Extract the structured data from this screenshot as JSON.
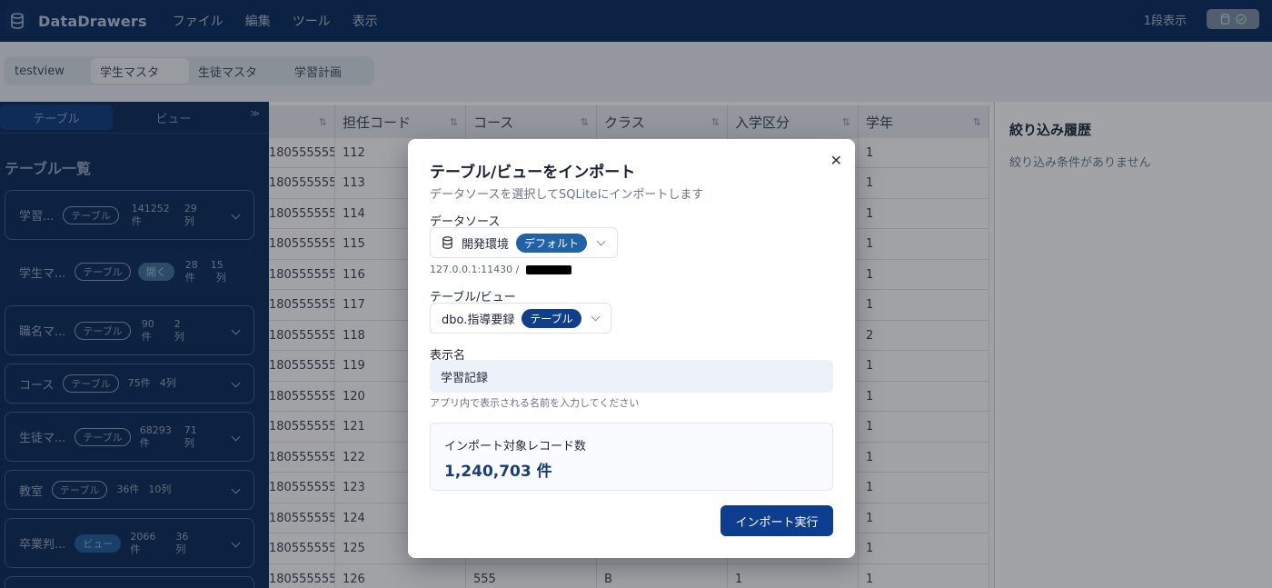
{
  "app": {
    "name": "DataDrawers"
  },
  "menu": [
    "ファイル",
    "編集",
    "ツール",
    "表示"
  ],
  "header_right": {
    "display_mode": "1段表示"
  },
  "tabs": [
    {
      "label": "testview"
    },
    {
      "label": "学生マスタ"
    },
    {
      "label": "生徒マスタ"
    },
    {
      "label": "学習計画"
    }
  ],
  "sidebar": {
    "toggle": {
      "table_label": "テーブル",
      "view_label": "ビュー"
    },
    "title": "テーブル一覧",
    "items": [
      {
        "name": "学習...",
        "type": "テーブル",
        "count": "141252",
        "count_unit": "件",
        "cols": "29",
        "cols_unit": "列"
      },
      {
        "name": "学生マ...",
        "type": "テーブル",
        "open": "開く",
        "count": "28",
        "count_unit": "件",
        "cols": "15",
        "cols_unit": "列"
      },
      {
        "name": "職名マ...",
        "type": "テーブル",
        "count": "90",
        "count_unit": "件",
        "cols": "2",
        "cols_unit": "列"
      },
      {
        "name": "コース",
        "type": "テーブル",
        "count_inline": "75件",
        "cols_inline": "4列"
      },
      {
        "name": "生徒マ...",
        "type": "テーブル",
        "count": "68293",
        "count_unit": "件",
        "cols": "71",
        "cols_unit": "列"
      },
      {
        "name": "教室",
        "type": "テーブル",
        "count_inline": "36件",
        "cols_inline": "10列"
      },
      {
        "name": "卒業判...",
        "type": "ビュー",
        "count": "2066",
        "count_unit": "件",
        "cols": "36",
        "cols_unit": "列"
      }
    ]
  },
  "grid": {
    "columns": [
      "",
      "担任コード",
      "コース",
      "クラス",
      "入学区分",
      "学年"
    ],
    "rows": [
      [
        "180555555",
        "112",
        "",
        "",
        "",
        "1"
      ],
      [
        "180555555",
        "113",
        "",
        "",
        "",
        "1"
      ],
      [
        "180555555",
        "114",
        "",
        "",
        "",
        "1"
      ],
      [
        "180555555",
        "115",
        "",
        "",
        "",
        "1"
      ],
      [
        "180555555",
        "116",
        "",
        "",
        "",
        "1"
      ],
      [
        "180555555",
        "117",
        "",
        "",
        "",
        "1"
      ],
      [
        "180555555",
        "118",
        "",
        "",
        "",
        "2"
      ],
      [
        "180555555",
        "119",
        "",
        "",
        "",
        "1"
      ],
      [
        "180555555",
        "120",
        "",
        "",
        "",
        "1"
      ],
      [
        "180555555",
        "121",
        "",
        "",
        "",
        "1"
      ],
      [
        "180555555",
        "122",
        "",
        "",
        "",
        "1"
      ],
      [
        "180555555",
        "123",
        "",
        "",
        "",
        "1"
      ],
      [
        "180555555",
        "124",
        "",
        "",
        "",
        "1"
      ],
      [
        "180555555",
        "125",
        "",
        "",
        "",
        "1"
      ],
      [
        "180555555",
        "126",
        "555",
        "B",
        "1",
        "1"
      ]
    ]
  },
  "filter_panel": {
    "title": "絞り込み履歴",
    "empty": "絞り込み条件がありません"
  },
  "modal": {
    "title": "テーブル/ビューをインポート",
    "subtitle": "データソースを選択してSQLiteにインポートします",
    "datasource_label": "データソース",
    "datasource_value": "開発環境",
    "datasource_badge": "デフォルト",
    "connection": "127.0.0.1:11430 /",
    "table_label": "テーブル/ビュー",
    "table_value": "dbo.指導要録",
    "table_badge": "テーブル",
    "display_name_label": "表示名",
    "display_name_value": "学習記録",
    "display_name_hint": "アプリ内で表示される名前を入力してください",
    "record_count_label": "インポート対象レコード数",
    "record_count_value": "1,240,703 件",
    "execute_label": "インポート実行"
  }
}
